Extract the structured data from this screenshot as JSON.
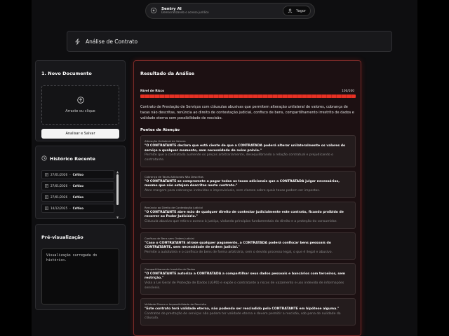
{
  "nav": {
    "app_name": "Sentry AI",
    "tagline": "Democratizando o acesso jurídico",
    "user_label": "Yagor"
  },
  "header": {
    "title": "Análise de Contrato"
  },
  "upload": {
    "title": "1. Novo Documento",
    "dropzone_text": "Arraste ou clique",
    "button_label": "Analisar e Salvar"
  },
  "history": {
    "title": "Histórico Recente",
    "items": [
      {
        "date": "27/01/2026",
        "separator": "-",
        "status": "Crítico"
      },
      {
        "date": "27/01/2026",
        "separator": "-",
        "status": "Crítico"
      },
      {
        "date": "27/01/2026",
        "separator": "-",
        "status": "Crítico"
      },
      {
        "date": "14/12/2025",
        "separator": "-",
        "status": "Crítico"
      }
    ]
  },
  "preview": {
    "title": "Pré-visualização",
    "text": "Visualização carregada do histórico."
  },
  "result": {
    "title": "Resultado da Análise",
    "risk_label": "Nível de Risco",
    "risk_score": "100/100",
    "risk_fraction": 1.0,
    "summary": "Contrato de Prestação de Serviços com cláusulas abusivas que permitem alteração unilateral de valores, cobrança de taxas não descritas, renúncia ao direito de contestação judicial, confisco de bens, compartilhamento irrestrito de dados e validade eterna sem possibilidade de rescisão.",
    "points_title": "Pontos de Atenção",
    "points": [
      {
        "title": "Alteração Unilateral de Valores",
        "quote": "\"O CONTRATANTE declara que está ciente de que a CONTRATADA poderá alterar unilateralmente os valores do serviço a qualquer momento, sem necessidade de aviso prévio.\"",
        "desc": "Permite que a contratada aumente os preços arbitrariamente, desequilibrando a relação contratual e prejudicando o contratante."
      },
      {
        "title": "Cobrança de Taxas Adicionais Não Descritas",
        "quote": "\"O CONTRATANTE se compromete a pagar todas as taxas adicionais que a CONTRATADA julgar necessárias, mesmo que não estejam descritas neste contrato.\"",
        "desc": "Abre margem para cobranças indevidas e imprevisíveis, sem clareza sobre quais taxas podem ser impostas."
      },
      {
        "title": "Renúncia ao Direito de Contestação Judicial",
        "quote": "\"O CONTRATANTE abre mão de qualquer direito de contestar judicialmente este contrato, ficando proibido de recorrer ao Poder Judiciário.\"",
        "desc": "Cláusula abusiva que retira o acesso à justiça, violando princípios fundamentais do direito e a proteção do consumidor."
      },
      {
        "title": "Confisco de Bens sem Ordem Judicial",
        "quote": "\"Caso o CONTRATANTE atrase qualquer pagamento, a CONTRATADA poderá confiscar bens pessoais do CONTRATANTE, sem necessidade de ordem judicial.\"",
        "desc": "Permite a autotutela e o confisco de bens de forma arbitrária, sem o devido processo legal, o que é ilegal e abusivo."
      },
      {
        "title": "Compartilhamento Irrestrito de Dados",
        "quote": "\"O CONTRATANTE autoriza a CONTRATADA a compartilhar seus dados pessoais e bancários com terceiros, sem restrição.\"",
        "desc": "Viola a Lei Geral de Proteção de Dados (LGPD) e expõe o contratante a riscos de vazamento e uso indevido de informações sensíveis."
      },
      {
        "title": "Validade Eterna e Impossibilidade de Rescisão",
        "quote": "\"Este contrato terá validade eterna, não podendo ser rescindido pelo CONTRATANTE em hipótese alguma.\"",
        "desc": "Contratos de prestação de serviços não podem ter validade eterna e devem permitir a rescisão, sob pena de nulidade da cláusula."
      }
    ]
  },
  "colors": {
    "accent_red": "#e63124",
    "card_bg": "#18181b",
    "page_bg": "#0e0e10"
  }
}
